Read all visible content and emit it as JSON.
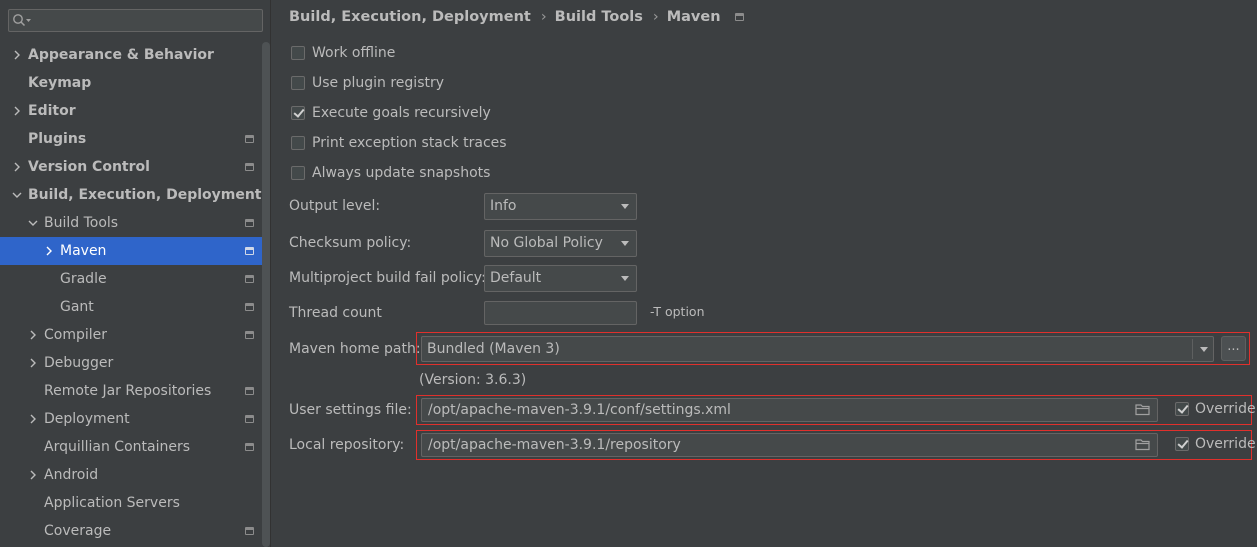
{
  "search": {
    "placeholder": "",
    "value": ""
  },
  "sidebar": {
    "items": [
      {
        "label": "Appearance & Behavior"
      },
      {
        "label": "Keymap"
      },
      {
        "label": "Editor"
      },
      {
        "label": "Plugins"
      },
      {
        "label": "Version Control"
      },
      {
        "label": "Build, Execution, Deployment"
      },
      {
        "label": "Build Tools"
      },
      {
        "label": "Maven"
      },
      {
        "label": "Gradle"
      },
      {
        "label": "Gant"
      },
      {
        "label": "Compiler"
      },
      {
        "label": "Debugger"
      },
      {
        "label": "Remote Jar Repositories"
      },
      {
        "label": "Deployment"
      },
      {
        "label": "Arquillian Containers"
      },
      {
        "label": "Android"
      },
      {
        "label": "Application Servers"
      },
      {
        "label": "Coverage"
      }
    ],
    "selected": "Maven"
  },
  "breadcrumb": {
    "items": [
      "Build, Execution, Deployment",
      "Build Tools",
      "Maven"
    ],
    "separator": "›"
  },
  "options": {
    "work_offline": {
      "label": "Work offline",
      "checked": false
    },
    "use_plugin_registry": {
      "label": "Use plugin registry",
      "checked": false
    },
    "execute_goals_recursively": {
      "label": "Execute goals recursively",
      "checked": true
    },
    "print_exception_stack_traces": {
      "label": "Print exception stack traces",
      "checked": false
    },
    "always_update_snapshots": {
      "label": "Always update snapshots",
      "checked": false
    }
  },
  "form": {
    "output_level": {
      "label": "Output level:",
      "value": "Info"
    },
    "checksum_policy": {
      "label": "Checksum policy:",
      "value": "No Global Policy"
    },
    "multiproject_fail_policy": {
      "label": "Multiproject build fail policy:",
      "value": "Default"
    },
    "thread_count": {
      "label": "Thread count",
      "value": "",
      "hint": "-T option"
    },
    "maven_home": {
      "label": "Maven home path:",
      "value": "Bundled (Maven 3)",
      "version": "(Version: 3.6.3)",
      "browse": "..."
    },
    "user_settings": {
      "label": "User settings file:",
      "value": "/opt/apache-maven-3.9.1/conf/settings.xml",
      "override_label": "Override",
      "override_checked": true
    },
    "local_repo": {
      "label": "Local repository:",
      "value": "/opt/apache-maven-3.9.1/repository",
      "override_label": "Override",
      "override_checked": true
    }
  },
  "colors": {
    "background": "#3c3f41",
    "selection": "#2f65ca",
    "highlight_border": "#e0302c",
    "text": "#bbbbbb"
  },
  "icons": {
    "search": "search-icon",
    "expand": "chevron-right-icon",
    "collapse": "chevron-down-icon",
    "project_level": "project-level-icon",
    "folder": "folder-icon"
  }
}
